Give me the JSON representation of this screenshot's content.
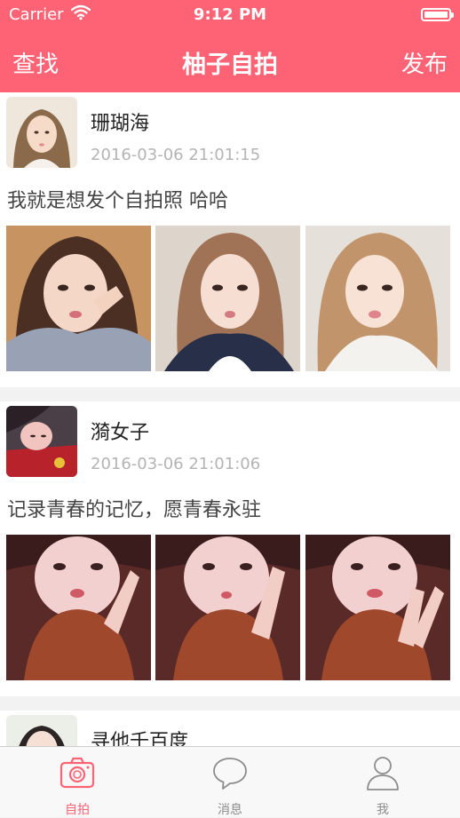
{
  "status_bar": {
    "carrier": "Carrier",
    "time": "9:12 PM"
  },
  "nav": {
    "left": "查找",
    "title": "柚子自拍",
    "right": "发布"
  },
  "posts": [
    {
      "name": "珊瑚海",
      "time": "2016-03-06 21:01:15",
      "text": "我就是想发个自拍照 哈哈",
      "photo_count": 3
    },
    {
      "name": "漪女子",
      "time": "2016-03-06 21:01:06",
      "text": "记录青春的记忆，愿青春永驻",
      "photo_count": 3
    },
    {
      "name": "寻他千百度",
      "time": "",
      "text": "",
      "photo_count": 0
    }
  ],
  "tabs": [
    {
      "label": "自拍",
      "icon": "camera-icon",
      "active": true
    },
    {
      "label": "消息",
      "icon": "chat-bubble-icon",
      "active": false
    },
    {
      "label": "我",
      "icon": "person-icon",
      "active": false
    }
  ],
  "colors": {
    "accent": "#fe6375",
    "background": "#f2f2f2",
    "timestamp": "#b4b4b4"
  }
}
